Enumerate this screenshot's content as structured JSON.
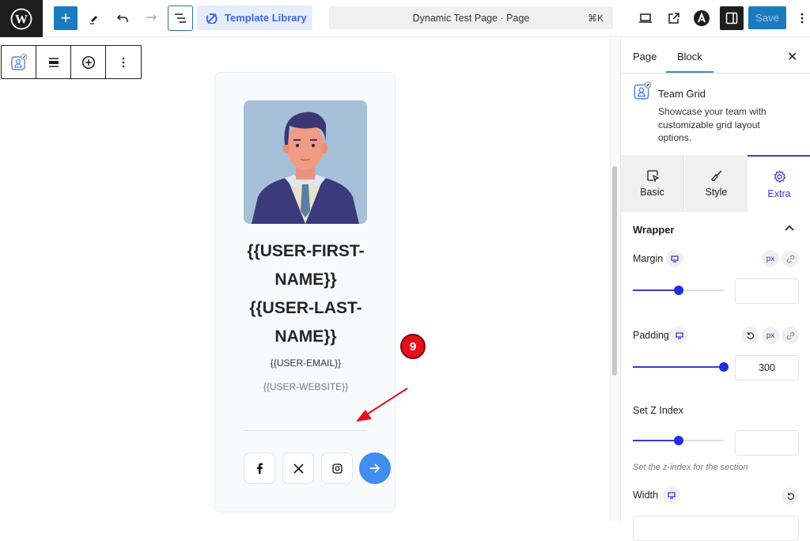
{
  "topbar": {
    "template_library_label": "Template Library",
    "document_title": "Dynamic Test Page · Page",
    "shortcut": "⌘K",
    "save_label": "Save",
    "icons": [
      "wordpress-logo",
      "add-block",
      "edit-pen",
      "undo",
      "redo",
      "document-outline",
      "template-library",
      "preview-desktop",
      "external-link",
      "astra",
      "settings-sidebar",
      "options-more"
    ]
  },
  "block_toolbar": {
    "icons": [
      "team-grid-block",
      "align",
      "insert",
      "more-options"
    ]
  },
  "card": {
    "first_name_line1": "{{USER-FIRST-",
    "first_name_line2": "NAME}}",
    "last_name_line1": "{{USER-LAST-",
    "last_name_line2": "NAME}}",
    "email": "{{USER-EMAIL}}",
    "website": "{{USER-WEBSITE}}",
    "social": [
      "facebook",
      "x-twitter",
      "instagram"
    ],
    "accent_color": "#3f8ef0"
  },
  "annotation": {
    "number": "9",
    "color": "#e5101b"
  },
  "sidebar": {
    "tabs": [
      {
        "label": "Page",
        "active": false
      },
      {
        "label": "Block",
        "active": true
      }
    ],
    "block": {
      "title": "Team Grid",
      "description": "Showcase your team with customizable grid layout options."
    },
    "panel_tabs": [
      {
        "label": "Basic",
        "active": false
      },
      {
        "label": "Style",
        "active": false
      },
      {
        "label": "Extra",
        "active": true
      }
    ],
    "section": {
      "title": "Wrapper",
      "expanded": true
    },
    "controls": {
      "margin": {
        "label": "Margin",
        "unit": "px",
        "value": "",
        "slider_percent": 50
      },
      "padding": {
        "label": "Padding",
        "unit": "px",
        "value": "300",
        "slider_percent": 100
      },
      "z_index": {
        "label": "Set Z Index",
        "value": "",
        "slider_percent": 50,
        "hint": "Set the z-index for the section"
      },
      "width": {
        "label": "Width"
      }
    },
    "accent_color": "#3b3bd1"
  }
}
